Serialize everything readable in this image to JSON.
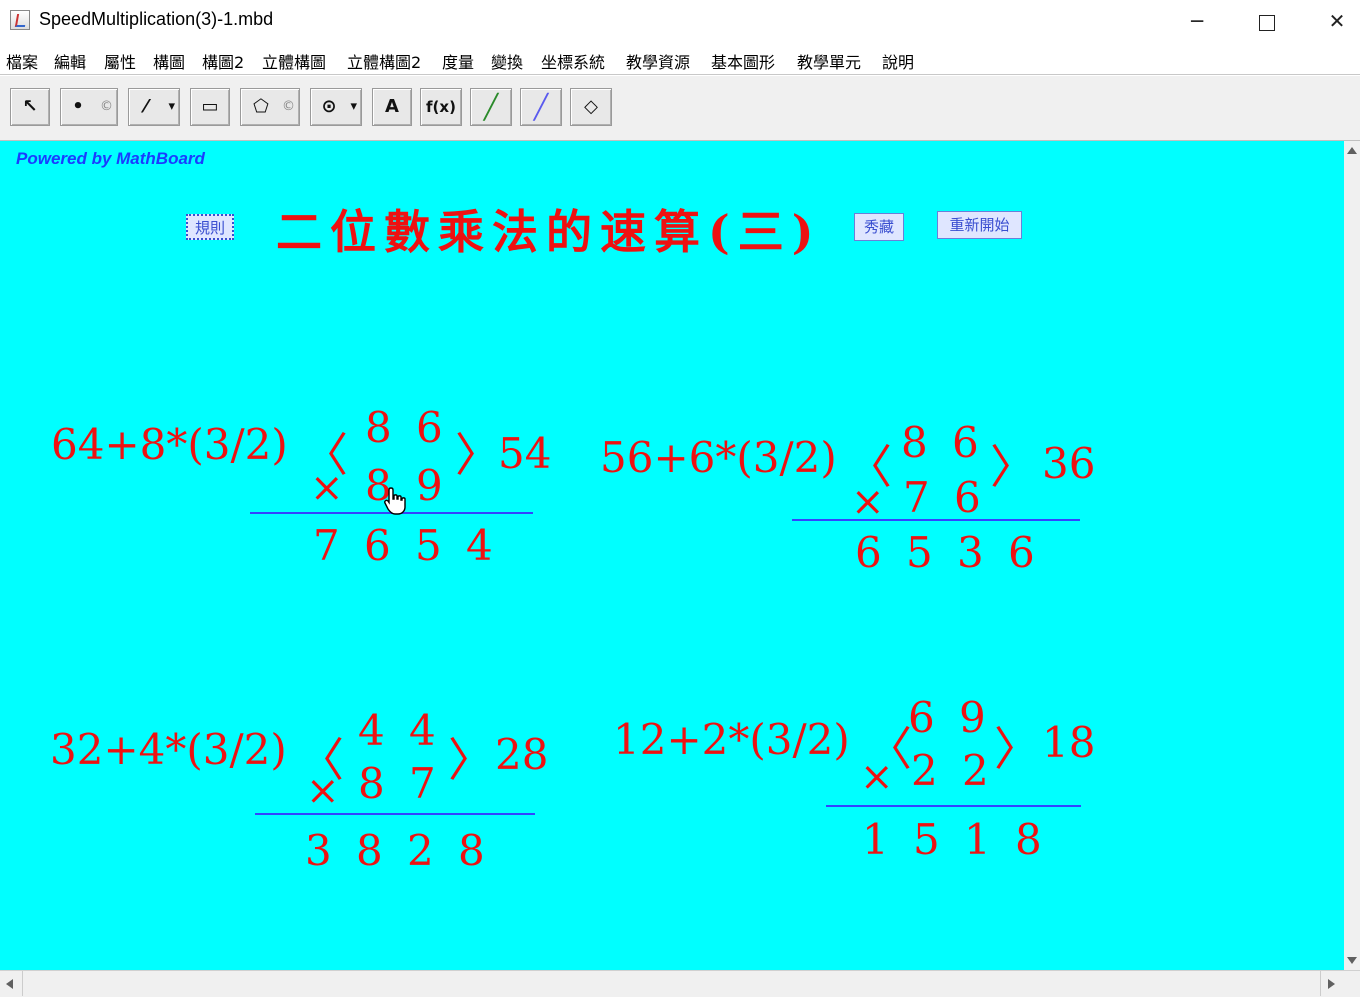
{
  "window": {
    "title": "SpeedMultiplication(3)-1.mbd",
    "minimize": "─",
    "close": "✕"
  },
  "menu": [
    "檔案",
    "編輯",
    "屬性",
    "構圖",
    "構圖2",
    "立體構圖",
    "立體構圖2",
    "度量",
    "變換",
    "坐標系統",
    "教學資源",
    "基本圖形",
    "教學單元",
    "說明"
  ],
  "toolbar": {
    "tools": [
      {
        "name": "select-tool",
        "glyph": "↖"
      },
      {
        "name": "point-tool",
        "glyph": "•",
        "sub": "©"
      },
      {
        "name": "line-tool",
        "glyph": "⁄",
        "sub": "▾"
      },
      {
        "name": "rectangle-tool",
        "glyph": "▭"
      },
      {
        "name": "polygon-tool",
        "glyph": "⬠",
        "sub": "©"
      },
      {
        "name": "circle-tool",
        "glyph": "⊙",
        "sub": "▾"
      },
      {
        "name": "text-tool",
        "glyph": "A"
      },
      {
        "name": "function-tool",
        "glyph": "f(x)"
      },
      {
        "name": "pen-tool",
        "glyph": "╱"
      },
      {
        "name": "highlighter-tool",
        "glyph": "╱"
      },
      {
        "name": "eraser-tool",
        "glyph": "◇"
      }
    ]
  },
  "canvas": {
    "powered_by": "Powered by MathBoard",
    "rules_button": "規則",
    "title": "二位數乘法的速算(三)",
    "show_hide_button": "秀藏",
    "restart_button": "重新開始",
    "problems": [
      {
        "formula": "64+8*(3/2)",
        "top": [
          "8",
          "6"
        ],
        "bottom": [
          "8",
          "9"
        ],
        "side": "54",
        "answer": [
          "7",
          "6",
          "5",
          "4"
        ]
      },
      {
        "formula": "56+6*(3/2)",
        "top": [
          "8",
          "6"
        ],
        "bottom": [
          "7",
          "6"
        ],
        "side": "36",
        "answer": [
          "6",
          "5",
          "3",
          "6"
        ]
      },
      {
        "formula": "32+4*(3/2)",
        "top": [
          "4",
          "4"
        ],
        "bottom": [
          "8",
          "7"
        ],
        "side": "28",
        "answer": [
          "3",
          "8",
          "2",
          "8"
        ]
      },
      {
        "formula": "12+2*(3/2)",
        "top": [
          "6",
          "9"
        ],
        "bottom": [
          "2",
          "2"
        ],
        "side": "18",
        "answer": [
          "1",
          "5",
          "1",
          "8"
        ]
      }
    ],
    "times_sign": "×",
    "open_bracket": "〈",
    "close_bracket": "〉"
  },
  "colors": {
    "canvas_bg": "#00ffff",
    "red_text": "#ee1111",
    "rule_line": "#3344ff",
    "powered_text": "#1a3cff"
  }
}
